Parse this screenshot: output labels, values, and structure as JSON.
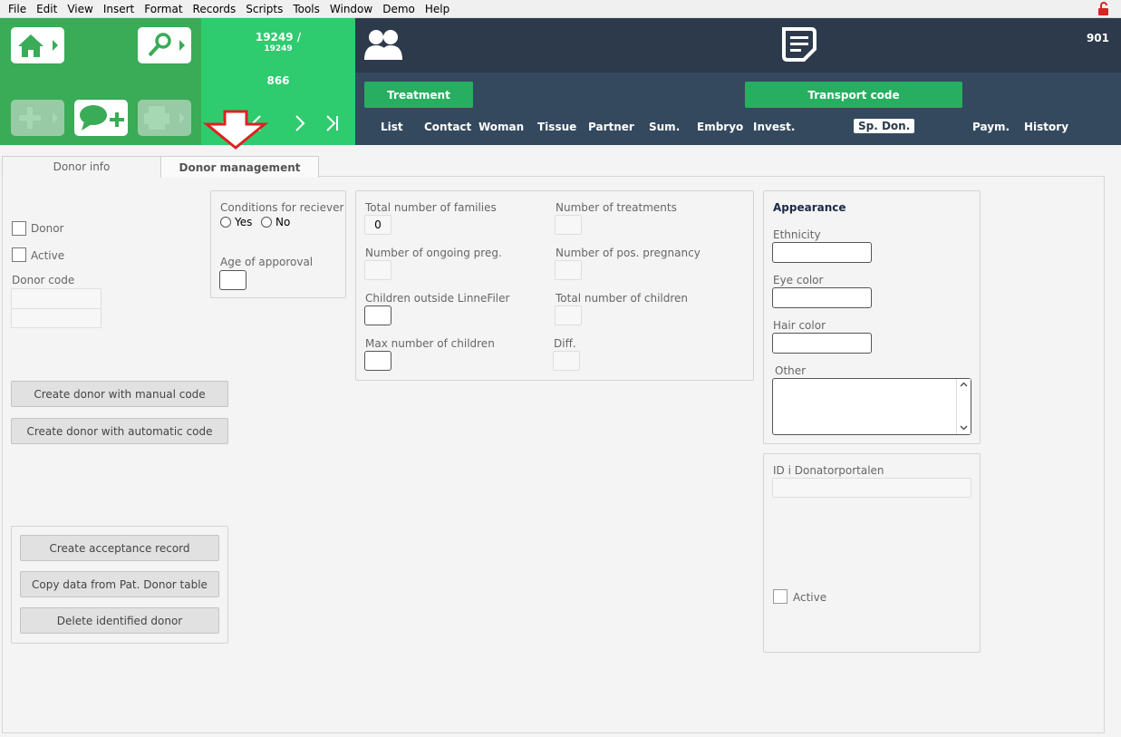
{
  "menu": [
    "File",
    "Edit",
    "View",
    "Insert",
    "Format",
    "Records",
    "Scripts",
    "Tools",
    "Window",
    "Demo",
    "Help"
  ],
  "header": {
    "record_current": "19249 /",
    "record_total": "19249",
    "record_id": "866",
    "right_number": "901",
    "treatment_label": "Treatment",
    "transport_label": "Transport code",
    "nav_tabs": [
      "List",
      "Contact",
      "Woman",
      "Tissue",
      "Partner",
      "Sum.",
      "Embryo",
      "Invest.",
      "Sp. Don.",
      "Paym.",
      "History"
    ],
    "active_nav": "Sp. Don.",
    "colors": {
      "green": "#3aab57",
      "light_green": "#2ecc6f",
      "dark": "#2c3a4b",
      "dark2": "#34495e",
      "button_green": "#27ae60",
      "arrow_red": "#e02020"
    }
  },
  "tabs": [
    "Donor info",
    "Donor management"
  ],
  "left": {
    "donor_label": "Donor",
    "active_label": "Active",
    "donor_code_label": "Donor code",
    "btn_manual": "Create donor with manual code",
    "btn_auto": "Create donor with automatic code",
    "btn_acceptance": "Create acceptance record",
    "btn_copy": "Copy data from Pat. Donor table",
    "btn_delete": "Delete identified donor"
  },
  "conditions": {
    "label": "Conditions for reciever",
    "yes": "Yes",
    "no": "No",
    "age_label": "Age of apporoval"
  },
  "stats": {
    "families_label": "Total number of families",
    "families_value": "0",
    "treatments_label": "Number of treatments",
    "ongoing_label": "Number of ongoing preg.",
    "pos_preg_label": "Number of pos. pregnancy",
    "children_outside_label": "Children outside LinneFiler",
    "total_children_label": "Total number of children",
    "max_children_label": "Max number of children",
    "diff_label": "Diff."
  },
  "appearance": {
    "title": "Appearance",
    "ethnicity": "Ethnicity",
    "eye": "Eye color",
    "hair": "Hair color",
    "other": "Other"
  },
  "portal": {
    "id_label": "ID i Donatorportalen",
    "active_label": "Active"
  }
}
